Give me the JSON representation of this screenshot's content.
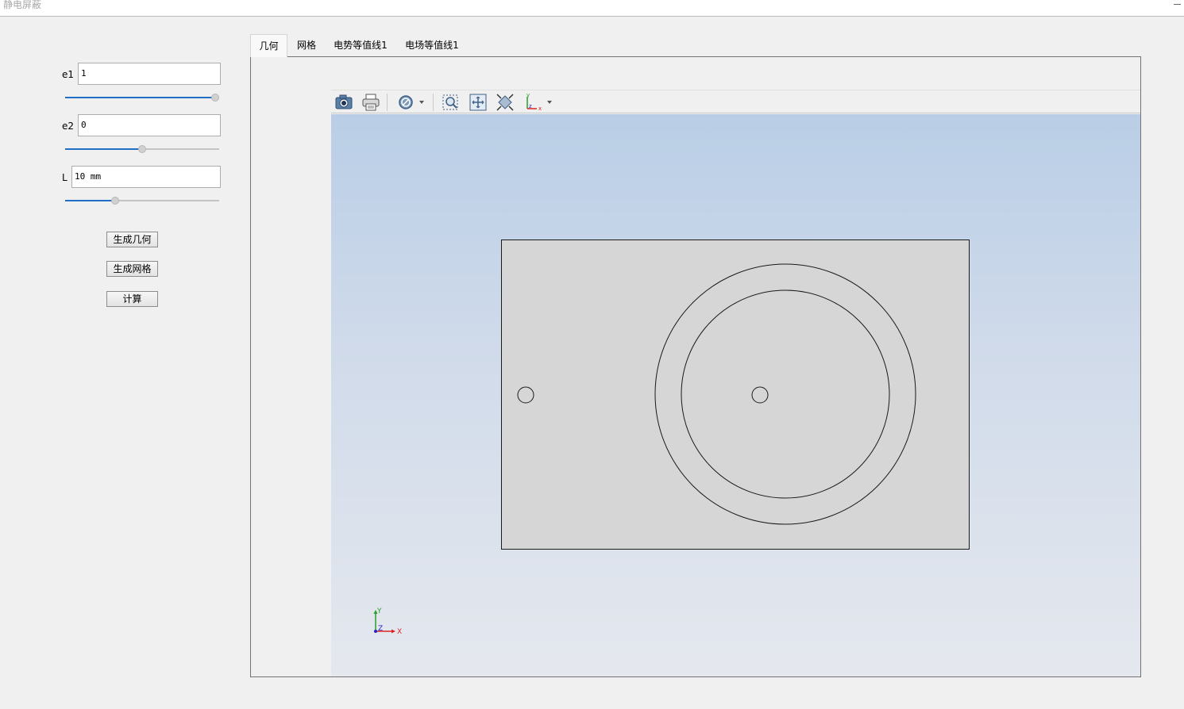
{
  "window": {
    "title": "静电屏蔽",
    "minimize_label": "—"
  },
  "params": [
    {
      "label": "e1",
      "value": "1",
      "slider_fraction": 1.0
    },
    {
      "label": "e2",
      "value": "0",
      "slider_fraction": 0.5
    },
    {
      "label": "L",
      "value": "10 mm",
      "slider_fraction": 0.33
    }
  ],
  "buttons": {
    "generate_geometry": "生成几何",
    "generate_mesh": "生成网格",
    "compute": "计算"
  },
  "tabs": [
    {
      "label": "几何",
      "active": true
    },
    {
      "label": "网格",
      "active": false
    },
    {
      "label": "电势等值线1",
      "active": false
    },
    {
      "label": "电场等值线1",
      "active": false
    }
  ],
  "toolbar": {
    "icons": [
      "camera-icon",
      "print-icon",
      "no-entry-icon",
      "zoom-box-icon",
      "zoom-extents-icon",
      "view-fit-icon",
      "axis-orientation-icon"
    ]
  },
  "axis_triad": {
    "x": "X",
    "y": "Y",
    "z": "Z"
  },
  "colors": {
    "accent": "#1f6fc5",
    "geometry_fill": "#d6d6d6",
    "geometry_stroke": "#1a1a1a"
  }
}
